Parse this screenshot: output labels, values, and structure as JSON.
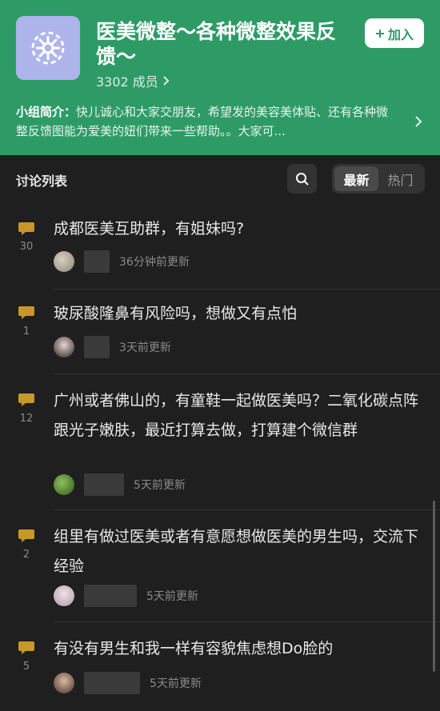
{
  "header": {
    "title": "医美微整～各种微整效果反馈～",
    "members": "3302 成员",
    "join_label": "加入",
    "intro_label": "小组简介：",
    "intro_text": "快儿诚心和大家交朋友，希望发的美容美体贴、还有各种微整反馈图能为爱美的妞们带来一些帮助。。大家可...",
    "color": "#2e9b67"
  },
  "toolbar": {
    "list_title": "讨论列表",
    "sort_new": "最新",
    "sort_hot": "热门"
  },
  "topics": [
    {
      "count": "30",
      "title": "成都医美互助群，有姐妹吗?",
      "time": "36分钟前更新"
    },
    {
      "count": "1",
      "title": "玻尿酸隆鼻有风险吗，想做又有点怕",
      "time": "3天前更新"
    },
    {
      "count": "12",
      "title": "广州或者佛山的，有童鞋一起做医美吗？二氧化碳点阵跟光子嫩肤，最近打算去做，打算建个微信群",
      "time": "5天前更新"
    },
    {
      "count": "2",
      "title": "组里有做过医美或者有意愿想做医美的男生吗，交流下经验",
      "time": "5天前更新"
    },
    {
      "count": "5",
      "title": "有没有男生和我一样有容貌焦虑想Do脸的",
      "time": "5天前更新"
    }
  ]
}
